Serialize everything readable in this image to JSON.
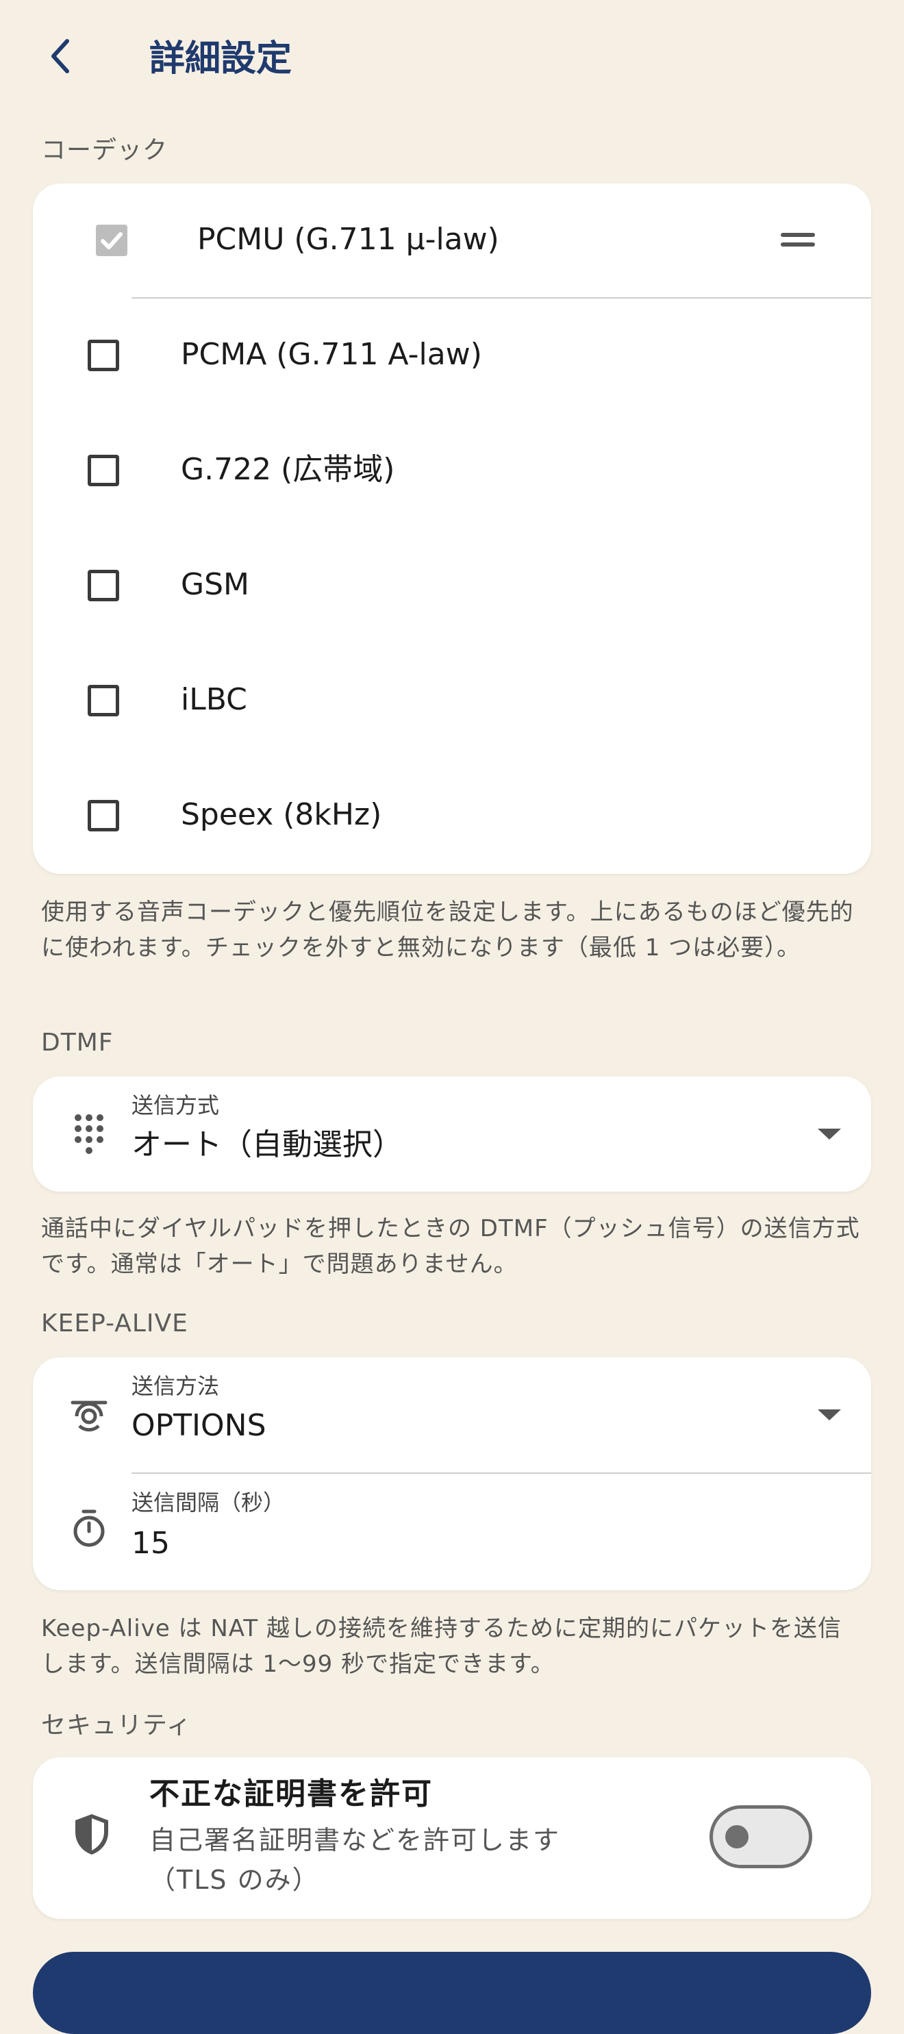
{
  "header": {
    "title": "詳細設定"
  },
  "codec": {
    "section_label": "コーデック",
    "items": [
      {
        "label": "PCMU (G.711 μ-law)",
        "checked": true
      },
      {
        "label": "PCMA (G.711 A-law)",
        "checked": false
      },
      {
        "label": "G.722 (広帯域)",
        "checked": false
      },
      {
        "label": "GSM",
        "checked": false
      },
      {
        "label": "iLBC",
        "checked": false
      },
      {
        "label": "Speex (8kHz)",
        "checked": false
      }
    ],
    "help": "使用する音声コーデックと優先順位を設定します。上にあるものほど優先的に使われます。チェックを外すと無効になります（最低 1 つは必要）。"
  },
  "dtmf": {
    "section_label": "DTMF",
    "field_label": "送信方式",
    "value": "オート（自動選択）",
    "help": "通話中にダイヤルパッドを押したときの DTMF（プッシュ信号）の送信方式です。通常は「オート」で問題ありません。"
  },
  "keepalive": {
    "section_label": "KEEP-ALIVE",
    "method_label": "送信方法",
    "method_value": "OPTIONS",
    "interval_label": "送信間隔（秒）",
    "interval_value": "15",
    "help": "Keep-Alive は NAT 越しの接続を維持するために定期的にパケットを送信します。送信間隔は 1〜99 秒で指定できます。"
  },
  "security": {
    "section_label": "セキュリティ",
    "title": "不正な証明書を許可",
    "description_line1": "自己署名証明書などを許可します",
    "description_line2": "（TLS のみ）",
    "enabled": false
  },
  "colors": {
    "background": "#F6F0E4",
    "accent": "#1F3A6E"
  }
}
